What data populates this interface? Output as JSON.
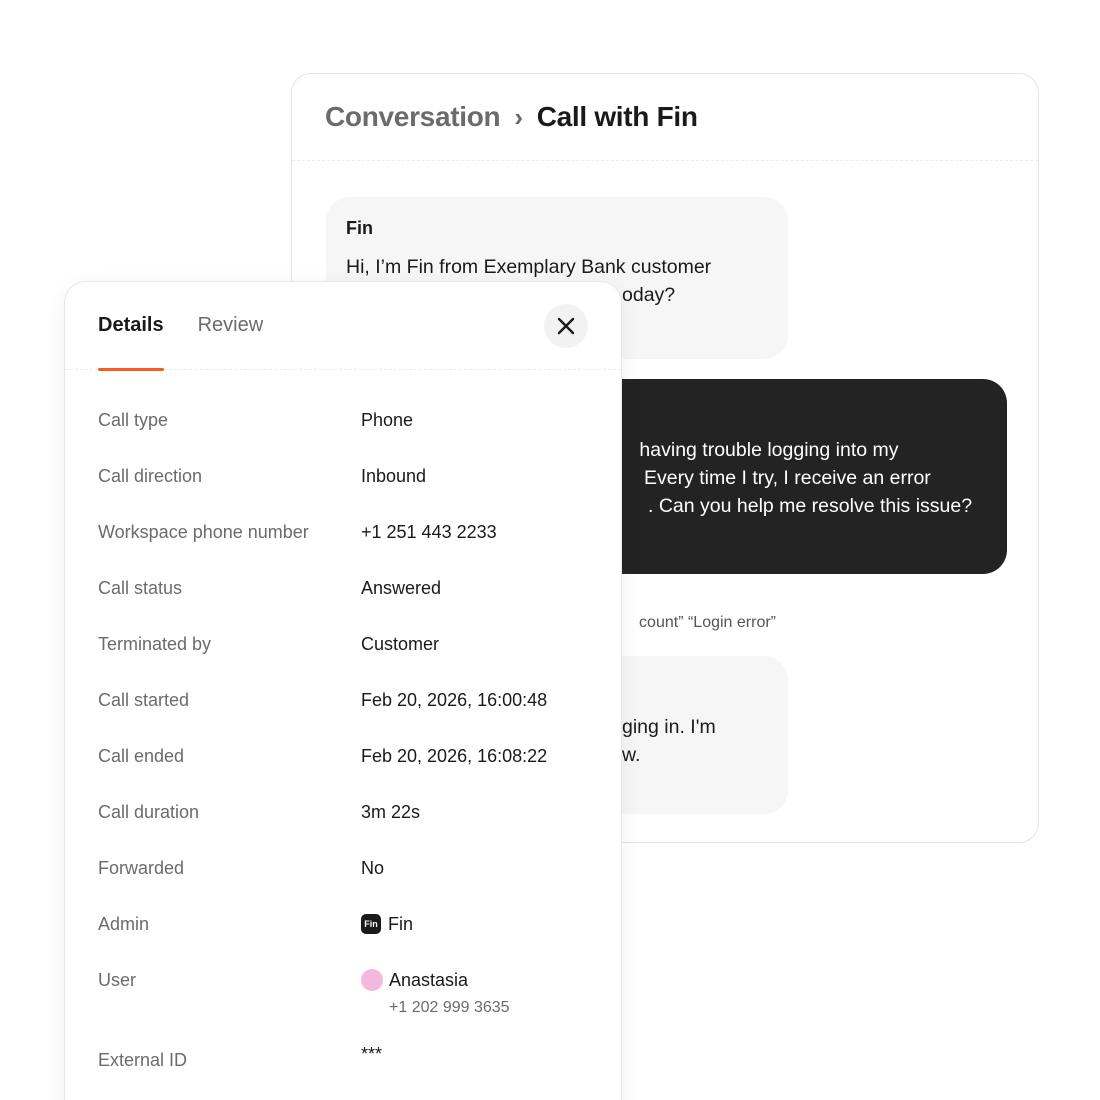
{
  "conversation": {
    "breadcrumb_root": "Conversation",
    "breadcrumb_separator": "›",
    "breadcrumb_current": "Call with Fin",
    "messages": [
      {
        "sender": "Fin",
        "lines": [
          "Hi, I’m Fin from Exemplary Bank customer",
          "oday?"
        ]
      },
      {
        "sender": "",
        "lines": [
          " having trouble logging into my",
          "Every time I try, I receive an error",
          ". Can you help me resolve this issue?"
        ]
      },
      {
        "sender": "",
        "lines": [
          "ging in. I'm",
          "w."
        ]
      }
    ],
    "tags_text": "count” “Login error”"
  },
  "details": {
    "tabs": [
      {
        "label": "Details",
        "active": true
      },
      {
        "label": "Review",
        "active": false
      }
    ],
    "rows": [
      {
        "label": "Call type",
        "value": "Phone"
      },
      {
        "label": "Call direction",
        "value": "Inbound"
      },
      {
        "label": "Workspace phone number",
        "value": "+1 251 443 2233"
      },
      {
        "label": "Call status",
        "value": "Answered"
      },
      {
        "label": "Terminated by",
        "value": "Customer"
      },
      {
        "label": "Call started",
        "value": "Feb 20, 2026, 16:00:48"
      },
      {
        "label": "Call ended",
        "value": "Feb 20, 2026, 16:08:22"
      },
      {
        "label": "Call duration",
        "value": "3m 22s"
      },
      {
        "label": "Forwarded",
        "value": "No"
      },
      {
        "label": "Admin",
        "value": "Fin",
        "badge_text": "Fin"
      },
      {
        "label": "User",
        "value": "Anastasia",
        "sub_value": "+1 202 999 3635"
      },
      {
        "label": "External ID",
        "value": "***"
      }
    ]
  },
  "colors": {
    "accent": "#ff5a1f",
    "dark_bubble": "#232323",
    "light_bubble": "#f6f6f6",
    "avatar": "#f2b8de"
  },
  "icons": {
    "close": "close-icon",
    "admin_badge": "fin-logo-icon",
    "user_avatar": "avatar"
  }
}
